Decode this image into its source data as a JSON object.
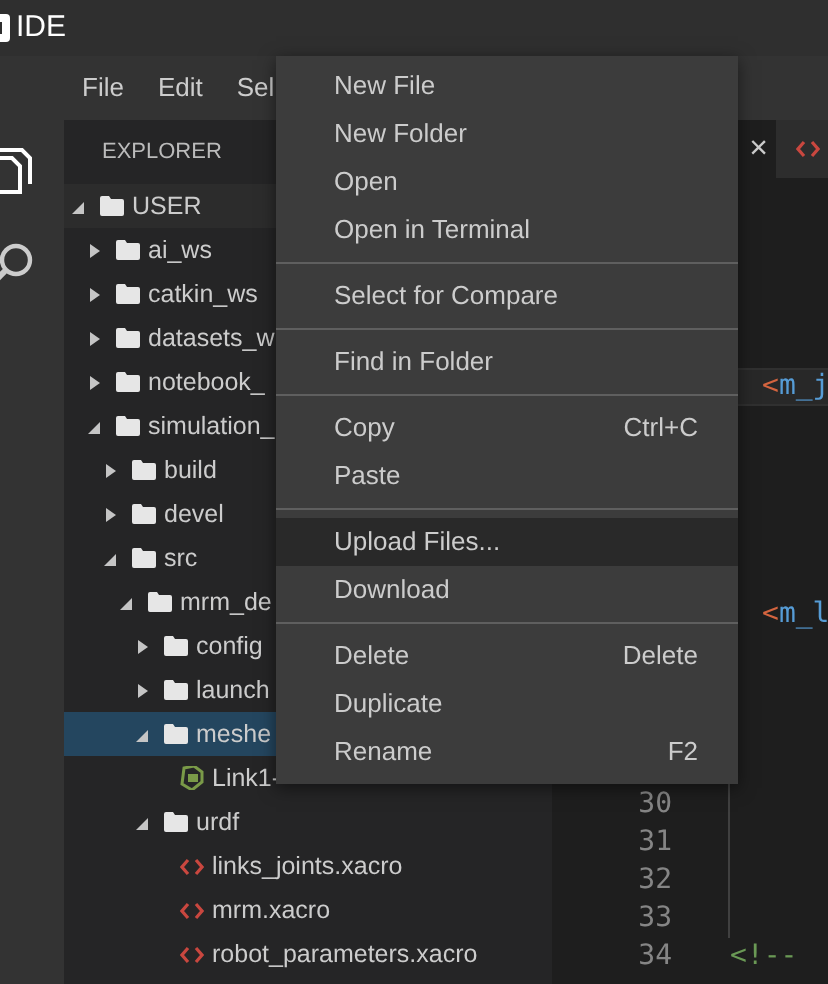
{
  "window": {
    "title": "IDE"
  },
  "menu_bar": [
    "File",
    "Edit",
    "Sel"
  ],
  "explorer": {
    "title": "EXPLORER",
    "tree": [
      {
        "label": "USER",
        "kind": "folder",
        "expanded": true,
        "selected": false,
        "children": [
          {
            "label": "ai_ws",
            "kind": "folder",
            "expanded": false,
            "selected": false
          },
          {
            "label": "catkin_ws",
            "kind": "folder",
            "expanded": false,
            "selected": false
          },
          {
            "label": "datasets_w",
            "kind": "folder",
            "expanded": false,
            "selected": false
          },
          {
            "label": "notebook_",
            "kind": "folder",
            "expanded": false,
            "selected": false
          },
          {
            "label": "simulation_",
            "kind": "folder",
            "expanded": true,
            "selected": false,
            "children": [
              {
                "label": "build",
                "kind": "folder",
                "expanded": false,
                "selected": false
              },
              {
                "label": "devel",
                "kind": "folder",
                "expanded": false,
                "selected": false
              },
              {
                "label": "src",
                "kind": "folder",
                "expanded": true,
                "selected": false,
                "children": [
                  {
                    "label": "mrm_de",
                    "kind": "folder",
                    "expanded": true,
                    "selected": false,
                    "children": [
                      {
                        "label": "config",
                        "kind": "folder",
                        "expanded": false,
                        "selected": false
                      },
                      {
                        "label": "launch",
                        "kind": "folder",
                        "expanded": false,
                        "selected": false
                      },
                      {
                        "label": "meshe",
                        "kind": "folder",
                        "expanded": true,
                        "selected": true,
                        "children": [
                          {
                            "label": "Link1-",
                            "kind": "model",
                            "selected": false
                          }
                        ]
                      },
                      {
                        "label": "urdf",
                        "kind": "folder",
                        "expanded": true,
                        "selected": false,
                        "children": [
                          {
                            "label": "links_joints.xacro",
                            "kind": "code",
                            "selected": false
                          },
                          {
                            "label": "mrm.xacro",
                            "kind": "code",
                            "selected": false
                          },
                          {
                            "label": "robot_parameters.xacro",
                            "kind": "code",
                            "selected": false
                          }
                        ]
                      }
                    ]
                  }
                ]
              }
            ]
          }
        ]
      }
    ]
  },
  "editor": {
    "tabs": [
      {
        "kind": "closable",
        "close": "×",
        "selected": true
      },
      {
        "kind": "code-file",
        "selected": false
      }
    ],
    "rows": [
      {},
      {},
      {},
      {},
      {},
      {
        "current": true,
        "indented": true,
        "tokens": [
          {
            "kind": "bracket",
            "text": "<"
          },
          {
            "kind": "name",
            "text": "m_j"
          }
        ]
      },
      {},
      {},
      {},
      {},
      {},
      {
        "current": false,
        "indented": true,
        "tokens": [
          {
            "kind": "bracket",
            "text": "<"
          },
          {
            "kind": "name",
            "text": "m_l"
          }
        ]
      },
      {},
      {},
      {},
      {},
      {
        "number": "30"
      },
      {
        "number": "31"
      },
      {
        "number": "32"
      },
      {
        "number": "33"
      },
      {
        "number": "34",
        "tokens": [
          {
            "kind": "comment",
            "text": "<!--"
          }
        ]
      }
    ]
  },
  "context_menu": {
    "groups": [
      [
        {
          "label": "New File",
          "hovered": false
        },
        {
          "label": "New Folder",
          "hovered": false
        },
        {
          "label": "Open",
          "hovered": false
        },
        {
          "label": "Open in Terminal",
          "hovered": false
        }
      ],
      [
        {
          "label": "Select for Compare",
          "hovered": false
        }
      ],
      [
        {
          "label": "Find in Folder",
          "hovered": false
        }
      ],
      [
        {
          "label": "Copy",
          "shortcut": "Ctrl+C",
          "hovered": false
        },
        {
          "label": "Paste",
          "hovered": false
        }
      ],
      [
        {
          "label": "Upload Files...",
          "hovered": true
        },
        {
          "label": "Download",
          "hovered": false
        }
      ],
      [
        {
          "label": "Delete",
          "shortcut": "Delete",
          "hovered": false
        },
        {
          "label": "Duplicate",
          "hovered": false
        },
        {
          "label": "Rename",
          "shortcut": "F2",
          "hovered": false
        }
      ]
    ]
  }
}
